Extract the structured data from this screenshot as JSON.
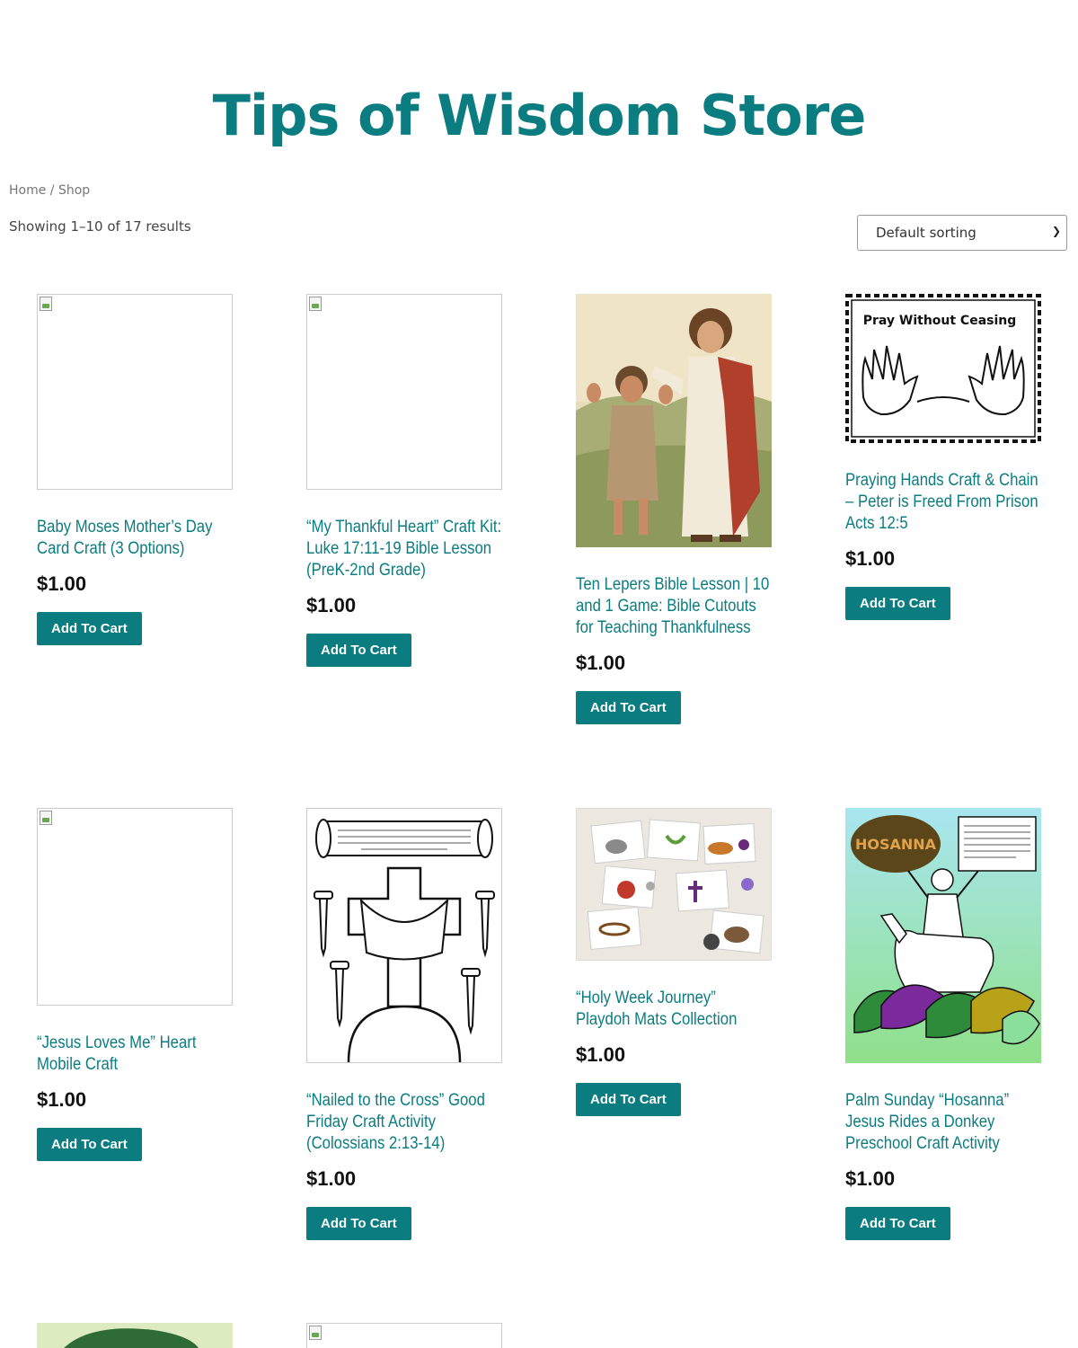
{
  "header": {
    "title": "Tips of Wisdom Store"
  },
  "breadcrumb": {
    "home": "Home",
    "separator": "/",
    "current": "Shop"
  },
  "shop": {
    "result_count": "Showing 1–10 of 17 results",
    "sorting": {
      "selected": "Default sorting"
    }
  },
  "colors": {
    "brand": "#0b7c80",
    "price": "#111111",
    "button_text": "#ffffff"
  },
  "products": [
    {
      "title": "Baby Moses Mother’s Day Card Craft (3 Options)",
      "price": "$1.00",
      "button": "Add To Cart"
    },
    {
      "title": "“My Thankful Heart” Craft Kit: Luke 17:11-19 Bible Lesson (PreK-2nd Grade)",
      "price": "$1.00",
      "button": "Add To Cart"
    },
    {
      "title": "Ten Lepers Bible Lesson | 10 and 1 Game: Bible Cutouts for Teaching Thankfulness",
      "price": "$1.00",
      "button": "Add To Cart"
    },
    {
      "title": "Praying Hands Craft & Chain – Peter is Freed From Prison Acts 12:5",
      "price": "$1.00",
      "button": "Add To Cart",
      "image_text": "Pray Without Ceasing"
    },
    {
      "title": "“Jesus Loves Me” Heart Mobile Craft",
      "price": "$1.00",
      "button": "Add To Cart"
    },
    {
      "title": "“Nailed to the Cross” Good Friday Craft Activity (Colossians 2:13-14)",
      "price": "$1.00",
      "button": "Add To Cart"
    },
    {
      "title": "“Holy Week Journey” Playdoh Mats Collection",
      "price": "$1.00",
      "button": "Add To Cart"
    },
    {
      "title": "Palm Sunday “Hosanna” Jesus Rides a Donkey Preschool Craft Activity",
      "price": "$1.00",
      "button": "Add To Cart",
      "image_text": "HOSANNA"
    }
  ]
}
